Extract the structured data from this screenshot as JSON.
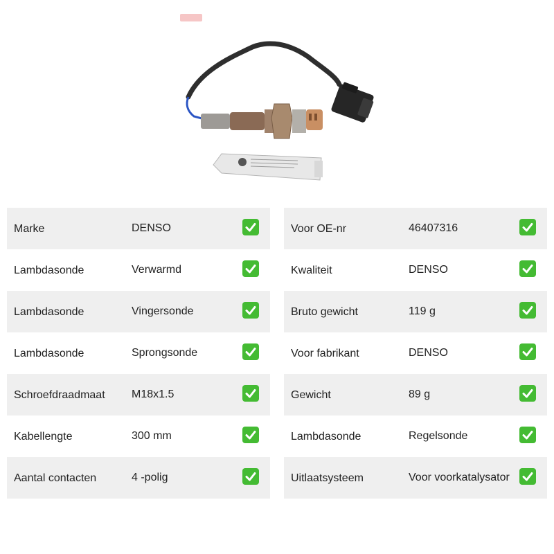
{
  "product": {
    "image_alt": "Lambda oxygen sensor with cable, connector and a tube of paste"
  },
  "colors": {
    "row_shade": "#efefef",
    "check_green": "#44bb33",
    "text": "#222222"
  },
  "left_table": [
    {
      "label": "Marke",
      "value": "DENSO",
      "icon": "check-icon"
    },
    {
      "label": "Lambdasonde",
      "value": "Verwarmd",
      "icon": "check-icon"
    },
    {
      "label": "Lambdasonde",
      "value": "Vingersonde",
      "icon": "check-icon"
    },
    {
      "label": "Lambdasonde",
      "value": "Sprongsonde",
      "icon": "check-icon"
    },
    {
      "label": "Schroefdraadmaat",
      "value": "M18x1.5",
      "icon": "check-icon"
    },
    {
      "label": "Kabellengte",
      "value": "300 mm",
      "icon": "check-icon"
    },
    {
      "label": "Aantal contacten",
      "value": "4 -polig",
      "icon": "check-icon"
    }
  ],
  "right_table": [
    {
      "label": "Voor OE-nr",
      "value": "46407316",
      "icon": "check-icon"
    },
    {
      "label": "Kwaliteit",
      "value": "DENSO",
      "icon": "check-icon"
    },
    {
      "label": "Bruto gewicht",
      "value": "119 g",
      "icon": "check-icon"
    },
    {
      "label": "Voor fabrikant",
      "value": "DENSO",
      "icon": "check-icon"
    },
    {
      "label": "Gewicht",
      "value": "89 g",
      "icon": "check-icon"
    },
    {
      "label": "Lambdasonde",
      "value": "Regelsonde",
      "icon": "check-icon"
    },
    {
      "label": "Uitlaatsysteem",
      "value": "Voor voorkatalysator",
      "icon": "check-icon"
    }
  ]
}
